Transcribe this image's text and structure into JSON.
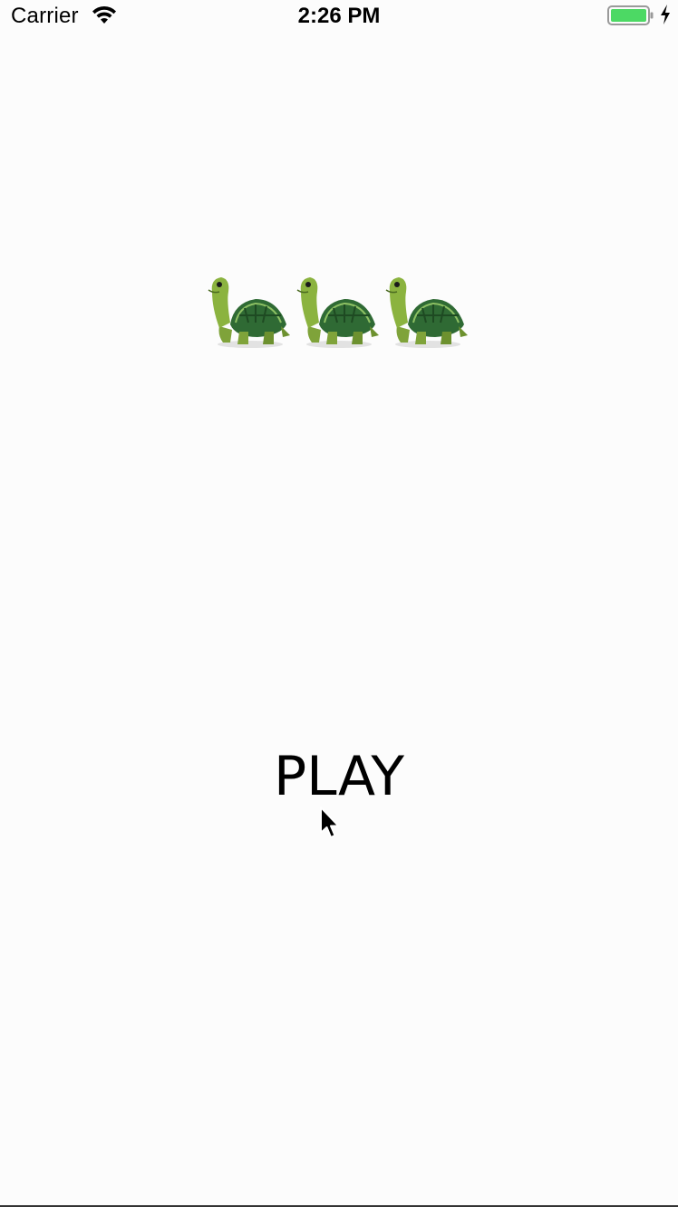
{
  "status_bar": {
    "carrier": "Carrier",
    "time": "2:26 PM",
    "wifi_icon": "wifi-icon",
    "battery_icon": "battery-charging-icon",
    "battery_color": "#4cd964"
  },
  "main": {
    "turtles": [
      "turtle-icon",
      "turtle-icon",
      "turtle-icon"
    ],
    "play_label": "PLAY"
  },
  "colors": {
    "background": "#fcfcfc",
    "text": "#000000"
  }
}
